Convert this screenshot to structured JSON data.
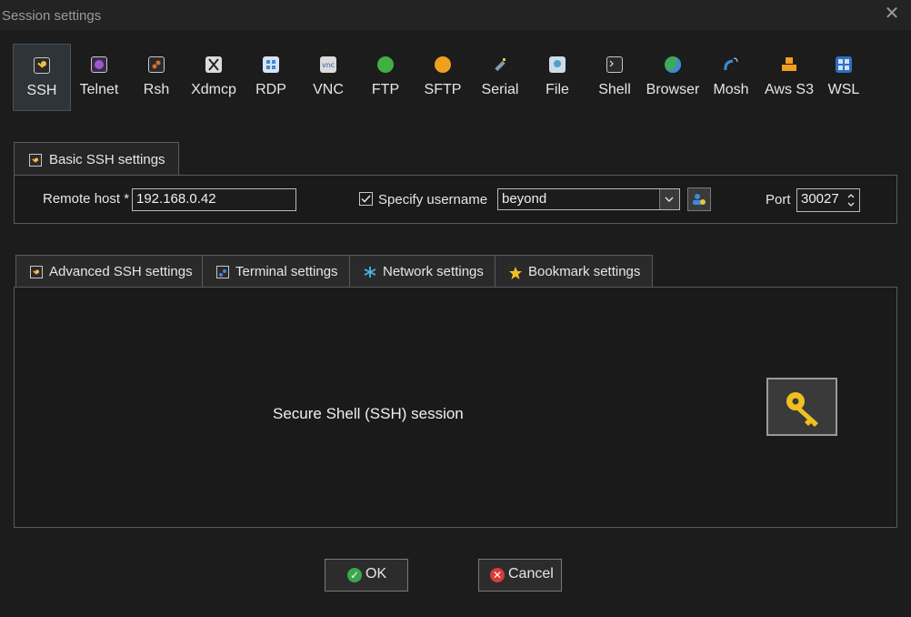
{
  "window": {
    "title": "Session settings"
  },
  "protocols": [
    {
      "label": "SSH",
      "color": "#f0c040",
      "selected": true
    },
    {
      "label": "Telnet",
      "color": "#9b59d0"
    },
    {
      "label": "Rsh",
      "color": "#d07030"
    },
    {
      "label": "Xdmcp",
      "color": "#dcdcdc"
    },
    {
      "label": "RDP",
      "color": "#3b8ad8"
    },
    {
      "label": "VNC",
      "color": "#dcdcdc"
    },
    {
      "label": "FTP",
      "color": "#40b040"
    },
    {
      "label": "SFTP",
      "color": "#f0a020"
    },
    {
      "label": "Serial",
      "color": "#8a9aa8"
    },
    {
      "label": "File",
      "color": "#4aa0d0"
    },
    {
      "label": "Shell",
      "color": "#606060"
    },
    {
      "label": "Browser",
      "color": "#3fa85a"
    },
    {
      "label": "Mosh",
      "color": "#3b8ad8"
    },
    {
      "label": "Aws S3",
      "color": "#f0a020"
    },
    {
      "label": "WSL",
      "color": "#3b8ad8"
    }
  ],
  "basic": {
    "tab_label": "Basic SSH settings",
    "remote_host_label": "Remote host *",
    "remote_host_value": "192.168.0.42",
    "specify_username_label": "Specify username",
    "specify_username_checked": true,
    "username_value": "beyond",
    "port_label": "Port",
    "port_value": "30027"
  },
  "tabs": [
    {
      "label": "Advanced SSH settings"
    },
    {
      "label": "Terminal settings"
    },
    {
      "label": "Network settings"
    },
    {
      "label": "Bookmark settings"
    }
  ],
  "content": {
    "description": "Secure Shell (SSH) session"
  },
  "buttons": {
    "ok": "OK",
    "cancel": "Cancel"
  }
}
